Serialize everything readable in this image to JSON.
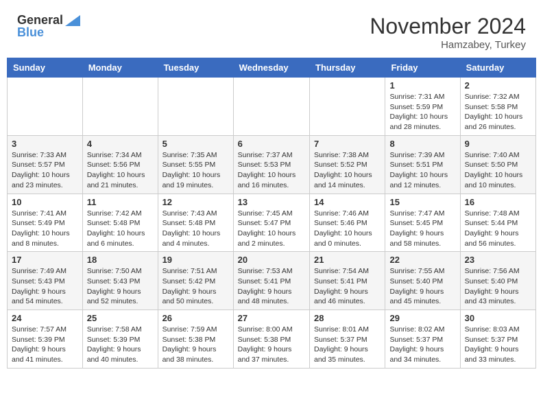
{
  "header": {
    "logo_general": "General",
    "logo_blue": "Blue",
    "month_title": "November 2024",
    "location": "Hamzabey, Turkey"
  },
  "weekdays": [
    "Sunday",
    "Monday",
    "Tuesday",
    "Wednesday",
    "Thursday",
    "Friday",
    "Saturday"
  ],
  "weeks": [
    [
      {
        "day": "",
        "info": ""
      },
      {
        "day": "",
        "info": ""
      },
      {
        "day": "",
        "info": ""
      },
      {
        "day": "",
        "info": ""
      },
      {
        "day": "",
        "info": ""
      },
      {
        "day": "1",
        "info": "Sunrise: 7:31 AM\nSunset: 5:59 PM\nDaylight: 10 hours and 28 minutes."
      },
      {
        "day": "2",
        "info": "Sunrise: 7:32 AM\nSunset: 5:58 PM\nDaylight: 10 hours and 26 minutes."
      }
    ],
    [
      {
        "day": "3",
        "info": "Sunrise: 7:33 AM\nSunset: 5:57 PM\nDaylight: 10 hours and 23 minutes."
      },
      {
        "day": "4",
        "info": "Sunrise: 7:34 AM\nSunset: 5:56 PM\nDaylight: 10 hours and 21 minutes."
      },
      {
        "day": "5",
        "info": "Sunrise: 7:35 AM\nSunset: 5:55 PM\nDaylight: 10 hours and 19 minutes."
      },
      {
        "day": "6",
        "info": "Sunrise: 7:37 AM\nSunset: 5:53 PM\nDaylight: 10 hours and 16 minutes."
      },
      {
        "day": "7",
        "info": "Sunrise: 7:38 AM\nSunset: 5:52 PM\nDaylight: 10 hours and 14 minutes."
      },
      {
        "day": "8",
        "info": "Sunrise: 7:39 AM\nSunset: 5:51 PM\nDaylight: 10 hours and 12 minutes."
      },
      {
        "day": "9",
        "info": "Sunrise: 7:40 AM\nSunset: 5:50 PM\nDaylight: 10 hours and 10 minutes."
      }
    ],
    [
      {
        "day": "10",
        "info": "Sunrise: 7:41 AM\nSunset: 5:49 PM\nDaylight: 10 hours and 8 minutes."
      },
      {
        "day": "11",
        "info": "Sunrise: 7:42 AM\nSunset: 5:48 PM\nDaylight: 10 hours and 6 minutes."
      },
      {
        "day": "12",
        "info": "Sunrise: 7:43 AM\nSunset: 5:48 PM\nDaylight: 10 hours and 4 minutes."
      },
      {
        "day": "13",
        "info": "Sunrise: 7:45 AM\nSunset: 5:47 PM\nDaylight: 10 hours and 2 minutes."
      },
      {
        "day": "14",
        "info": "Sunrise: 7:46 AM\nSunset: 5:46 PM\nDaylight: 10 hours and 0 minutes."
      },
      {
        "day": "15",
        "info": "Sunrise: 7:47 AM\nSunset: 5:45 PM\nDaylight: 9 hours and 58 minutes."
      },
      {
        "day": "16",
        "info": "Sunrise: 7:48 AM\nSunset: 5:44 PM\nDaylight: 9 hours and 56 minutes."
      }
    ],
    [
      {
        "day": "17",
        "info": "Sunrise: 7:49 AM\nSunset: 5:43 PM\nDaylight: 9 hours and 54 minutes."
      },
      {
        "day": "18",
        "info": "Sunrise: 7:50 AM\nSunset: 5:43 PM\nDaylight: 9 hours and 52 minutes."
      },
      {
        "day": "19",
        "info": "Sunrise: 7:51 AM\nSunset: 5:42 PM\nDaylight: 9 hours and 50 minutes."
      },
      {
        "day": "20",
        "info": "Sunrise: 7:53 AM\nSunset: 5:41 PM\nDaylight: 9 hours and 48 minutes."
      },
      {
        "day": "21",
        "info": "Sunrise: 7:54 AM\nSunset: 5:41 PM\nDaylight: 9 hours and 46 minutes."
      },
      {
        "day": "22",
        "info": "Sunrise: 7:55 AM\nSunset: 5:40 PM\nDaylight: 9 hours and 45 minutes."
      },
      {
        "day": "23",
        "info": "Sunrise: 7:56 AM\nSunset: 5:40 PM\nDaylight: 9 hours and 43 minutes."
      }
    ],
    [
      {
        "day": "24",
        "info": "Sunrise: 7:57 AM\nSunset: 5:39 PM\nDaylight: 9 hours and 41 minutes."
      },
      {
        "day": "25",
        "info": "Sunrise: 7:58 AM\nSunset: 5:39 PM\nDaylight: 9 hours and 40 minutes."
      },
      {
        "day": "26",
        "info": "Sunrise: 7:59 AM\nSunset: 5:38 PM\nDaylight: 9 hours and 38 minutes."
      },
      {
        "day": "27",
        "info": "Sunrise: 8:00 AM\nSunset: 5:38 PM\nDaylight: 9 hours and 37 minutes."
      },
      {
        "day": "28",
        "info": "Sunrise: 8:01 AM\nSunset: 5:37 PM\nDaylight: 9 hours and 35 minutes."
      },
      {
        "day": "29",
        "info": "Sunrise: 8:02 AM\nSunset: 5:37 PM\nDaylight: 9 hours and 34 minutes."
      },
      {
        "day": "30",
        "info": "Sunrise: 8:03 AM\nSunset: 5:37 PM\nDaylight: 9 hours and 33 minutes."
      }
    ]
  ]
}
